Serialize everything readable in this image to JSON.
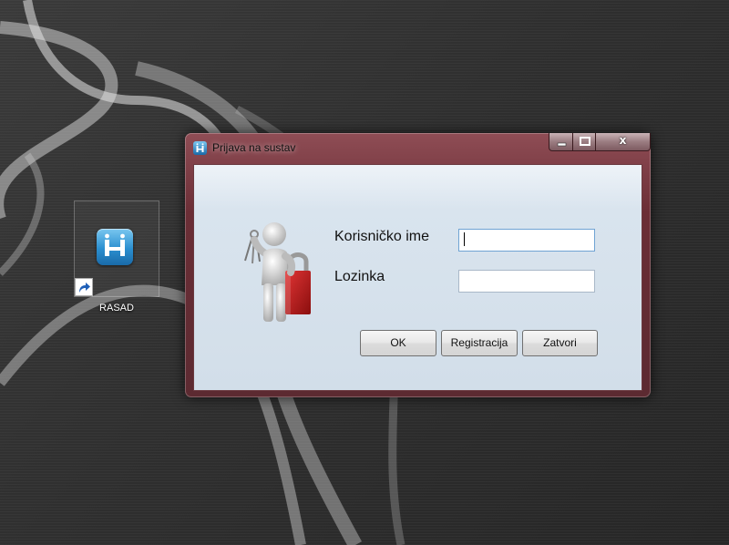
{
  "desktop": {
    "icon": {
      "label": "RASAD",
      "icon": "app-icon",
      "overlay": "shortcut-arrow-icon"
    }
  },
  "window": {
    "title": "Prijava na sustav",
    "title_icon": "app-icon",
    "caption_buttons": {
      "minimize": "minimize-icon",
      "maximize": "maximize-icon",
      "close": "x"
    },
    "form": {
      "username_label": "Korisničko ime",
      "username_value": "",
      "password_label": "Lozinka",
      "password_value": ""
    },
    "buttons": {
      "ok": "OK",
      "register": "Registracija",
      "close": "Zatvori"
    },
    "illustration": "person-with-keys-and-lock"
  },
  "colors": {
    "frame": "#6b2e36",
    "client_bg": "#d2dee9",
    "accent": "#2b8fd0"
  }
}
